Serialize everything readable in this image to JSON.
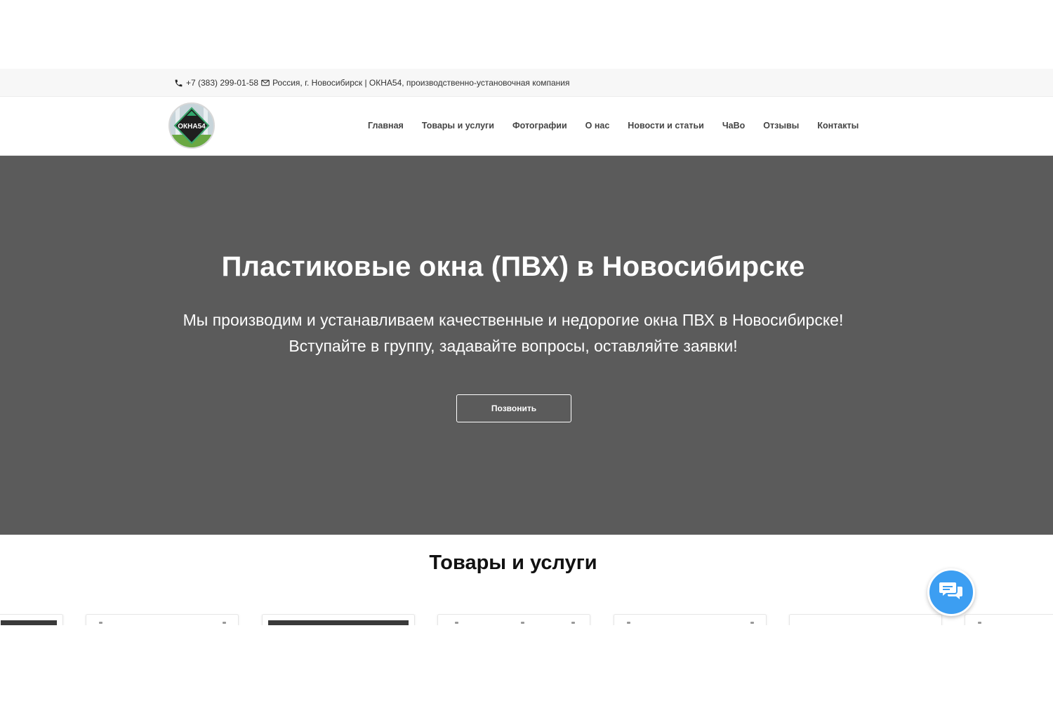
{
  "topbar": {
    "phone": "+7 (383) 299-01-58",
    "info": "Россия, г. Новосибирск | ОКНА54, производственно-установочная компания"
  },
  "logo": {
    "text": "ОКНА54"
  },
  "nav": {
    "items": [
      {
        "label": "Главная"
      },
      {
        "label": "Товары и услуги"
      },
      {
        "label": "Фотографии"
      },
      {
        "label": "О нас"
      },
      {
        "label": "Новости и статьи"
      },
      {
        "label": "ЧаВо"
      },
      {
        "label": "Отзывы"
      },
      {
        "label": "Контакты"
      }
    ]
  },
  "hero": {
    "title": "Пластиковые окна (ПВХ) в Новосибирске",
    "subtitle_line1": "Мы производим и устанавливаем качественные и недорогие окна ПВХ в Новосибирске!",
    "subtitle_line2": "Вступайте в группу, задавайте вопросы, оставляйте заявки!",
    "button": "Позвонить"
  },
  "products": {
    "title": "Товары и услуги"
  },
  "colors": {
    "hero_bg": "#5b5b5b",
    "chat_button": "#3c9ef2",
    "topbar_bg": "#f7f7f7"
  },
  "icons": {
    "phone": "phone-icon",
    "mail": "mail-icon",
    "chat": "chat-icon"
  }
}
